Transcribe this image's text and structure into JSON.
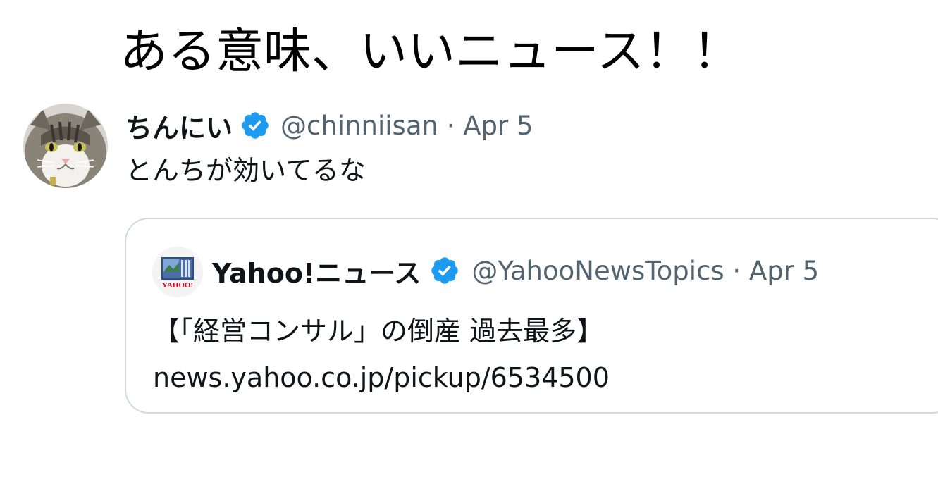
{
  "caption": "ある意味、いいニュース！！",
  "tweet": {
    "display_name": "ちんにい",
    "handle": "@chinniisan",
    "separator": "·",
    "date": "Apr 5",
    "text": "とんちが効いてるな",
    "avatar_icon": "cat-avatar",
    "verified_icon": "verified-badge-icon",
    "verified_color": "#1d9bf0"
  },
  "quoted_tweet": {
    "display_name": "Yahoo!ニュース",
    "handle": "@YahooNewsTopics",
    "separator": "·",
    "date": "Apr 5",
    "text_line1": "【「経営コンサル」の倒産 過去最多】",
    "text_line2": "news.yahoo.co.jp/pickup/6534500",
    "avatar_logo_text": "YAHOO!",
    "avatar_icon": "yahoo-news-logo",
    "verified_icon": "verified-badge-icon",
    "verified_color": "#1d9bf0"
  }
}
